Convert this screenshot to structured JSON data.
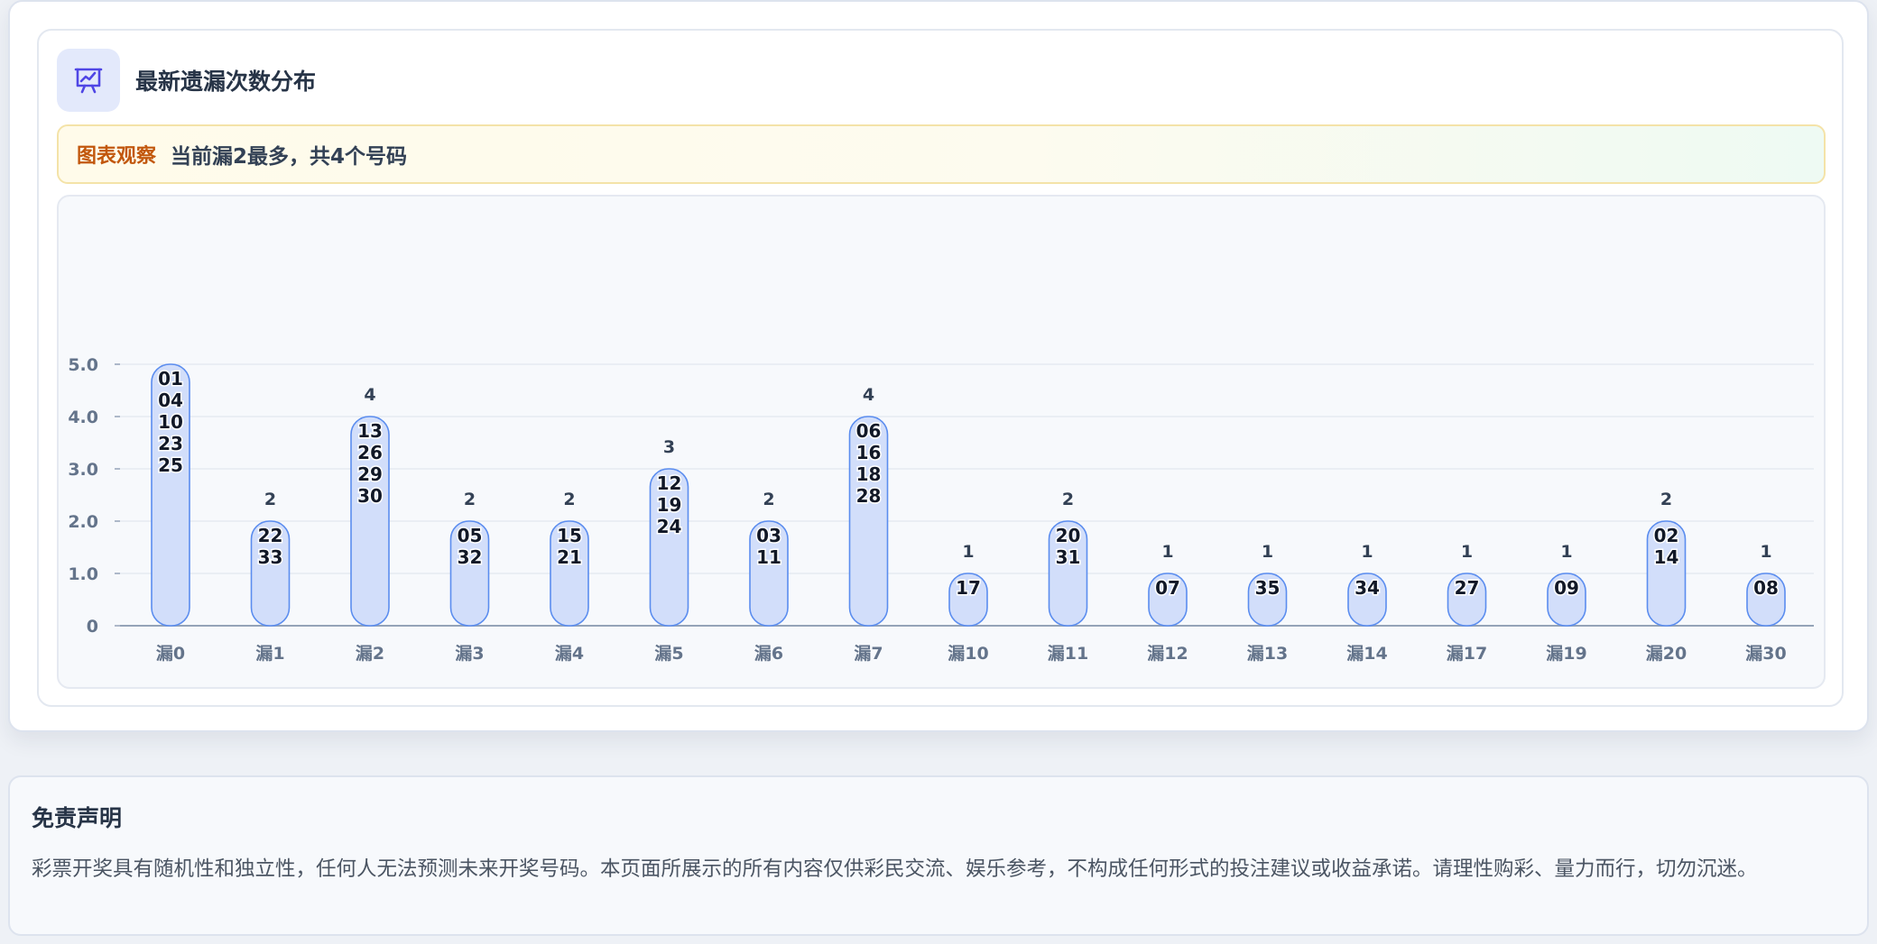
{
  "header": {
    "title": "最新遗漏次数分布",
    "icon": "presentation-chart-icon"
  },
  "observation": {
    "tag": "图表观察",
    "text": "当前漏2最多，共4个号码"
  },
  "chart_data": {
    "type": "bar",
    "title": "",
    "xlabel": "",
    "ylabel": "",
    "ylim": [
      0,
      5
    ],
    "y_ticks": [
      "0",
      "1.0",
      "2.0",
      "3.0",
      "4.0",
      "5.0"
    ],
    "grid": true,
    "categories": [
      "漏0",
      "漏1",
      "漏2",
      "漏3",
      "漏4",
      "漏5",
      "漏6",
      "漏7",
      "漏10",
      "漏11",
      "漏12",
      "漏13",
      "漏14",
      "漏17",
      "漏19",
      "漏20",
      "漏30"
    ],
    "values": [
      5,
      2,
      4,
      2,
      2,
      3,
      2,
      4,
      1,
      2,
      1,
      1,
      1,
      1,
      1,
      2,
      1
    ],
    "value_labels": [
      "",
      "2",
      "4",
      "2",
      "2",
      "3",
      "2",
      "4",
      "1",
      "2",
      "1",
      "1",
      "1",
      "1",
      "1",
      "2",
      "1"
    ],
    "numbers": [
      [
        "01",
        "04",
        "10",
        "23",
        "25"
      ],
      [
        "22",
        "33"
      ],
      [
        "13",
        "26",
        "29",
        "30"
      ],
      [
        "05",
        "32"
      ],
      [
        "15",
        "21"
      ],
      [
        "12",
        "19",
        "24"
      ],
      [
        "03",
        "11"
      ],
      [
        "06",
        "16",
        "18",
        "28"
      ],
      [
        "17"
      ],
      [
        "20",
        "31"
      ],
      [
        "07"
      ],
      [
        "35"
      ],
      [
        "34"
      ],
      [
        "27"
      ],
      [
        "09"
      ],
      [
        "02",
        "14"
      ],
      [
        "08"
      ]
    ],
    "colors": {
      "bar_fill": "#d2defa",
      "bar_stroke": "#5b8def",
      "grid": "#e6eaf1",
      "axis": "#94a3b8",
      "tick_text": "#64748b",
      "value_text": "#334155"
    }
  },
  "disclaimer": {
    "title": "免责声明",
    "text": "彩票开奖具有随机性和独立性，任何人无法预测未来开奖号码。本页面所展示的所有内容仅供彩民交流、娱乐参考，不构成任何形式的投注建议或收益承诺。请理性购彩、量力而行，切勿沉迷。"
  }
}
